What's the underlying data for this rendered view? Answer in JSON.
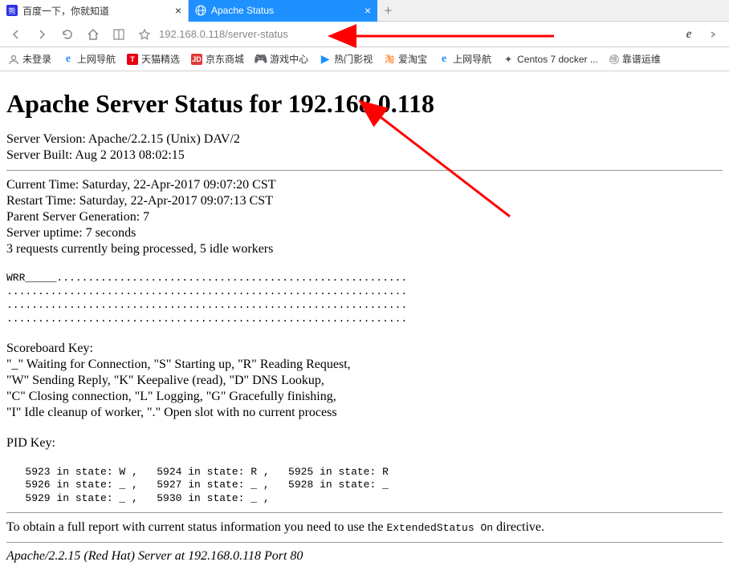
{
  "tabs": {
    "inactive": {
      "title": "百度一下，你就知道"
    },
    "active": {
      "title": "Apache Status"
    }
  },
  "url": "192.168.0.118/server-status",
  "bookmarks": [
    {
      "label": "未登录"
    },
    {
      "label": "上网导航"
    },
    {
      "label": "天猫精选"
    },
    {
      "label": "京东商城"
    },
    {
      "label": "游戏中心"
    },
    {
      "label": "热门影视"
    },
    {
      "label": "爱淘宝"
    },
    {
      "label": "上网导航"
    },
    {
      "label": "Centos 7 docker ..."
    },
    {
      "label": "靠谱运维"
    }
  ],
  "page": {
    "heading": "Apache Server Status for 192.168.0.118",
    "version": "Server Version: Apache/2.2.15 (Unix) DAV/2",
    "built": "Server Built: Aug 2 2013 08:02:15",
    "current_time": "Current Time: Saturday, 22-Apr-2017 09:07:20 CST",
    "restart_time": "Restart Time: Saturday, 22-Apr-2017 09:07:13 CST",
    "generation": "Parent Server Generation: 7",
    "uptime": "Server uptime: 7 seconds",
    "requests": "3 requests currently being processed, 5 idle workers",
    "scoreboard": "WRR_____........................................................\n................................................................\n................................................................\n................................................................",
    "key_title": "Scoreboard Key:",
    "key1": "\"_\" Waiting for Connection, \"S\" Starting up, \"R\" Reading Request,",
    "key2": "\"W\" Sending Reply, \"K\" Keepalive (read), \"D\" DNS Lookup,",
    "key3": "\"C\" Closing connection, \"L\" Logging, \"G\" Gracefully finishing,",
    "key4": "\"I\" Idle cleanup of worker, \".\" Open slot with no current process",
    "pid_title": "PID Key:",
    "pid_data": "   5923 in state: W ,   5924 in state: R ,   5925 in state: R\n   5926 in state: _ ,   5927 in state: _ ,   5928 in state: _\n   5929 in state: _ ,   5930 in state: _ ,",
    "footer_text_pre": "To obtain a full report with current status information you need to use the ",
    "footer_code": "ExtendedStatus On",
    "footer_text_post": " directive.",
    "address": "Apache/2.2.15 (Red Hat) Server at 192.168.0.118 Port 80"
  }
}
